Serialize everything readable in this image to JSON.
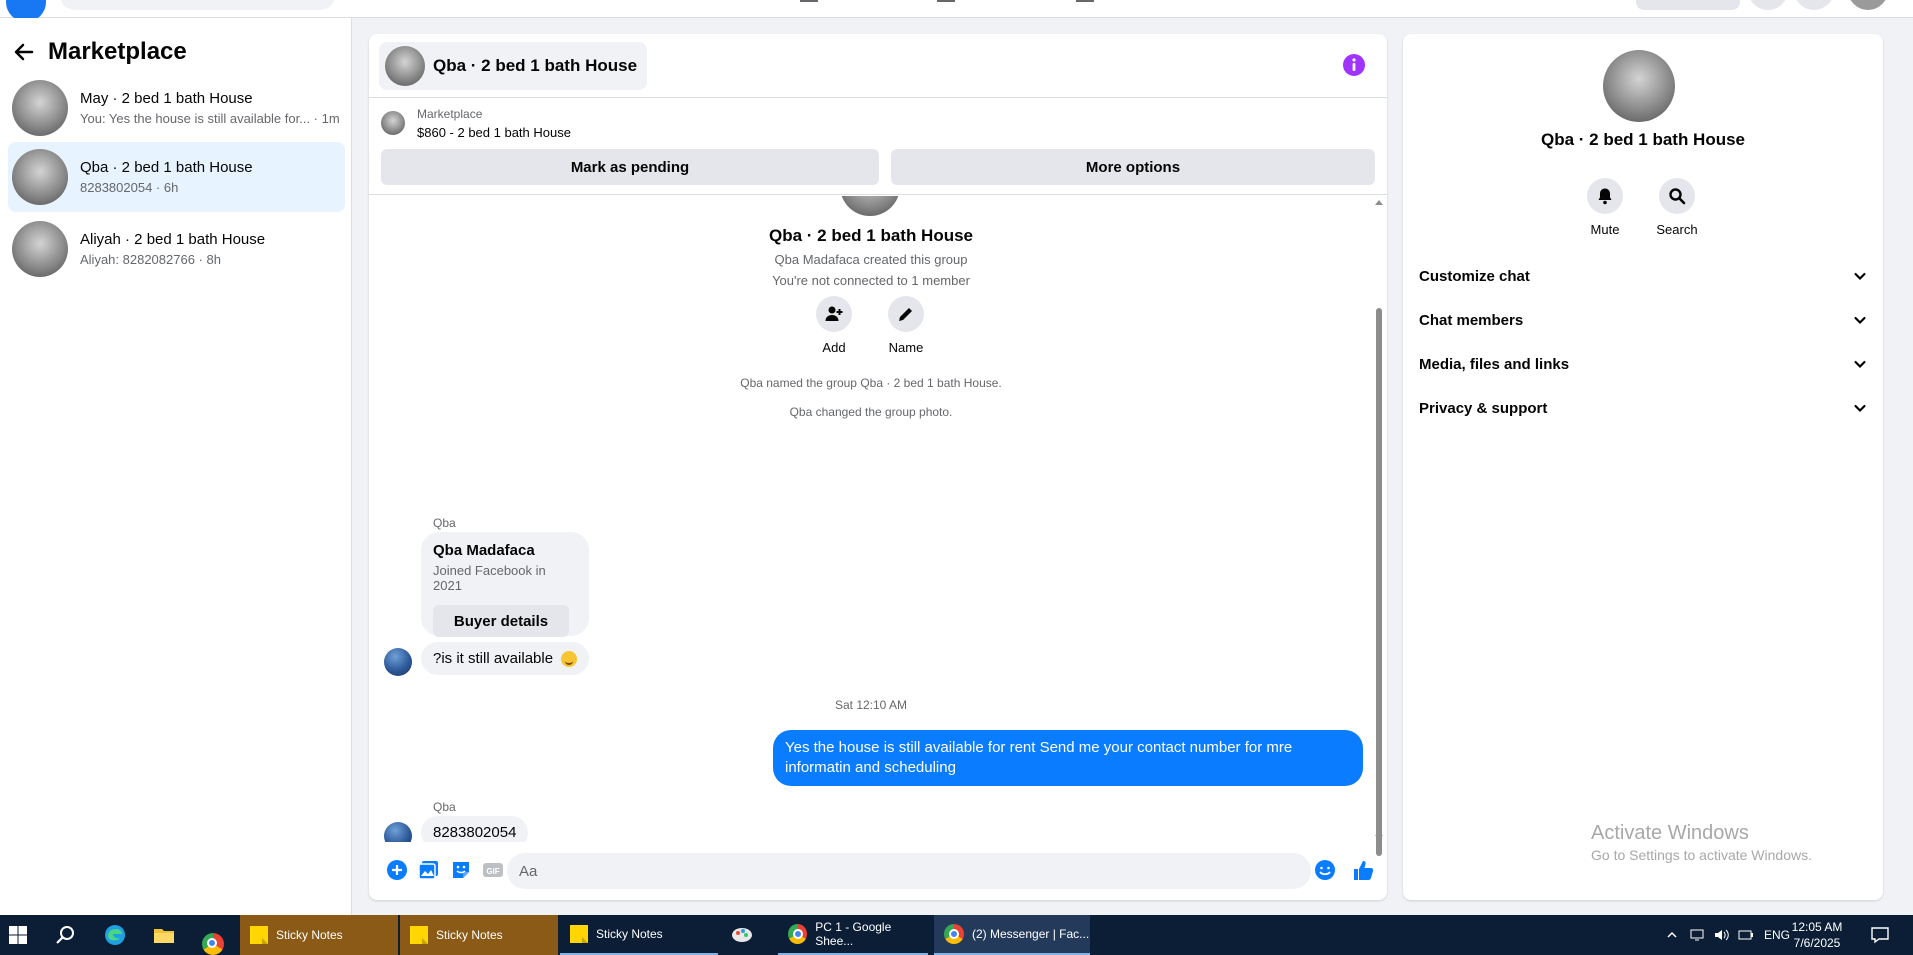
{
  "sidebar": {
    "title": "Marketplace",
    "conversations": [
      {
        "name": "May · 2 bed 1 bath House",
        "preview": "You: Yes the house is still available for... · 1m",
        "active": false
      },
      {
        "name": "Qba · 2 bed 1 bath House",
        "preview": "8283802054 · 6h",
        "active": true
      },
      {
        "name": "Aliyah · 2 bed 1 bath House",
        "preview": "Aliyah: 8282082766 · 8h",
        "active": false
      }
    ]
  },
  "chat": {
    "title": "Qba · 2 bed 1 bath House",
    "listing": {
      "label": "Marketplace",
      "price_title": "$860 - 2 bed 1 bath House",
      "mark_pending": "Mark as pending",
      "more_options": "More options"
    },
    "group": {
      "name": "Qba · 2 bed 1 bath House",
      "created_by": "Qba Madafaca created this group",
      "not_connected": "You're not connected to 1 member",
      "add_label": "Add",
      "name_label": "Name"
    },
    "system_messages": [
      "Qba named the group Qba · 2 bed 1 bath House.",
      "Qba changed the group photo."
    ],
    "buyer_card": {
      "sender": "Qba",
      "name": "Qba Madafaca",
      "joined": "Joined Facebook in 2021",
      "button": "Buyer details"
    },
    "messages": {
      "first_incoming": "?is it still available",
      "timestamp": "Sat 12:10 AM",
      "outgoing": "Yes the house is still available for rent Send me your contact number for mre informatin and  scheduling",
      "second_sender": "Qba",
      "second_incoming": "8283802054"
    },
    "composer": {
      "placeholder": "Aa",
      "value": ""
    }
  },
  "info_panel": {
    "title": "Qba · 2 bed 1 bath House",
    "mute_label": "Mute",
    "search_label": "Search",
    "sections": [
      "Customize chat",
      "Chat members",
      "Media, files and links",
      "Privacy & support"
    ],
    "watermark_title": "Activate Windows",
    "watermark_sub": "Go to Settings to activate Windows."
  },
  "taskbar": {
    "apps": [
      {
        "label": "Sticky Notes",
        "icon": "sticky-notes-icon"
      },
      {
        "label": "Sticky Notes",
        "icon": "sticky-notes-icon"
      },
      {
        "label": "Sticky Notes",
        "icon": "sticky-notes-icon"
      },
      {
        "label": "PC 1 - Google Shee...",
        "icon": "chrome-icon"
      },
      {
        "label": "(2) Messenger | Fac...",
        "icon": "chrome-icon"
      }
    ],
    "language": "ENG",
    "time": "12:05 AM",
    "date": "7/6/2025"
  },
  "colors": {
    "accent": "#0a7cff",
    "info_purple": "#a033ff",
    "active_conversation": "#e7f3ff",
    "taskbar": "#0b1e36"
  }
}
